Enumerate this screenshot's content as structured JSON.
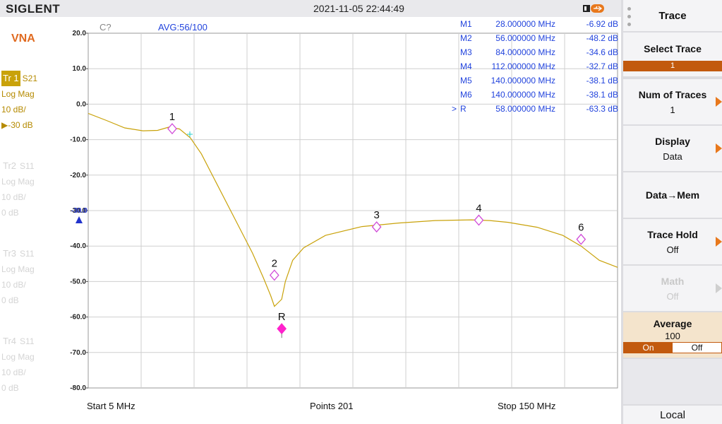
{
  "header": {
    "brand": "SIGLENT",
    "datetime": "2021-11-05 22:44:49"
  },
  "left_panel": {
    "mode": "VNA",
    "traces": [
      {
        "id": "Tr 1",
        "param": "S21",
        "format": "Log Mag",
        "scale": "10 dB/",
        "ref": "-30 dB",
        "active": true
      },
      {
        "id": "Tr2",
        "param": "S11",
        "format": "Log Mag",
        "scale": "10 dB/",
        "ref": "0 dB",
        "active": false
      },
      {
        "id": "Tr3",
        "param": "S11",
        "format": "Log Mag",
        "scale": "10 dB/",
        "ref": "0 dB",
        "active": false
      },
      {
        "id": "Tr4",
        "param": "S11",
        "format": "Log Mag",
        "scale": "10 dB/",
        "ref": "0 dB",
        "active": false
      }
    ]
  },
  "chart": {
    "cal_status": "C?",
    "avg_status": "AVG:56/100",
    "start_label": "Start  5 MHz",
    "points_label": "Points  201",
    "stop_label": "Stop  150 MHz",
    "ref_level_marker": "-30.0",
    "markers_table": [
      {
        "name": "M1",
        "freq": "28.000000 MHz",
        "value": "-6.92 dB",
        "active": false
      },
      {
        "name": "M2",
        "freq": "56.000000 MHz",
        "value": "-48.2 dB",
        "active": false
      },
      {
        "name": "M3",
        "freq": "84.000000 MHz",
        "value": "-34.6 dB",
        "active": false
      },
      {
        "name": "M4",
        "freq": "112.000000 MHz",
        "value": "-32.7 dB",
        "active": false
      },
      {
        "name": "M5",
        "freq": "140.000000 MHz",
        "value": "-38.1 dB",
        "active": false
      },
      {
        "name": "M6",
        "freq": "140.000000 MHz",
        "value": "-38.1 dB",
        "active": false
      },
      {
        "name": "R",
        "freq": "58.000000 MHz",
        "value": "-63.3 dB",
        "active": true
      }
    ]
  },
  "chart_data": {
    "type": "line",
    "title": "",
    "xlabel": "",
    "ylabel": "",
    "xlim": [
      5,
      150
    ],
    "ylim": [
      -80,
      20
    ],
    "grid": true,
    "y_ticks": [
      "20.0",
      "10.0",
      "0.0",
      "-10.0",
      "-20.0",
      "-30.0",
      "-40.0",
      "-50.0",
      "-60.0",
      "-70.0",
      "-80.0"
    ],
    "series": [
      {
        "x": [
          5,
          10,
          15,
          20,
          24,
          27,
          30,
          33,
          36,
          40,
          45,
          50,
          53,
          55,
          56,
          57,
          58,
          59,
          61,
          64,
          70,
          80,
          90,
          100,
          110,
          115,
          120,
          128,
          135,
          140,
          145,
          150
        ],
        "y": [
          -2.6,
          -4.6,
          -6.7,
          -7.5,
          -7.4,
          -6.5,
          -7.0,
          -9.5,
          -14,
          -22,
          -32,
          -42,
          -49,
          -54,
          -57,
          -56,
          -55,
          -50,
          -44,
          -40.5,
          -37,
          -34.5,
          -33.5,
          -32.8,
          -32.6,
          -32.8,
          -33.3,
          -34.7,
          -37,
          -40,
          -44,
          -46
        ]
      }
    ],
    "markers": [
      {
        "label": "1",
        "x": 28,
        "y": -6.92
      },
      {
        "label": "2",
        "x": 56,
        "y": -48.2
      },
      {
        "label": "3",
        "x": 84,
        "y": -34.6
      },
      {
        "label": "4",
        "x": 112,
        "y": -32.7
      },
      {
        "label": "6",
        "x": 140,
        "y": -38.1
      },
      {
        "label": "R",
        "x": 58,
        "y": -63.3
      }
    ],
    "colors": {
      "trace": "#c9a20a",
      "marker": "#d04ad8",
      "ref_marker": "#ff22cc",
      "marker_text": "#2244dd",
      "grid": "#cfcfcf"
    }
  },
  "right_panel": {
    "menu_title": "Trace",
    "buttons": [
      {
        "title": "Select Trace",
        "selected": "1"
      },
      {
        "title": "Num of Traces",
        "value": "1"
      },
      {
        "title": "Display",
        "value": "Data"
      },
      {
        "title": "Data→Mem"
      },
      {
        "title": "Trace Hold",
        "value": "Off"
      },
      {
        "title": "Math",
        "value": "Off"
      },
      {
        "title": "Average",
        "value": "100",
        "on": "On",
        "off": "Off"
      }
    ],
    "local_label": "Local"
  }
}
